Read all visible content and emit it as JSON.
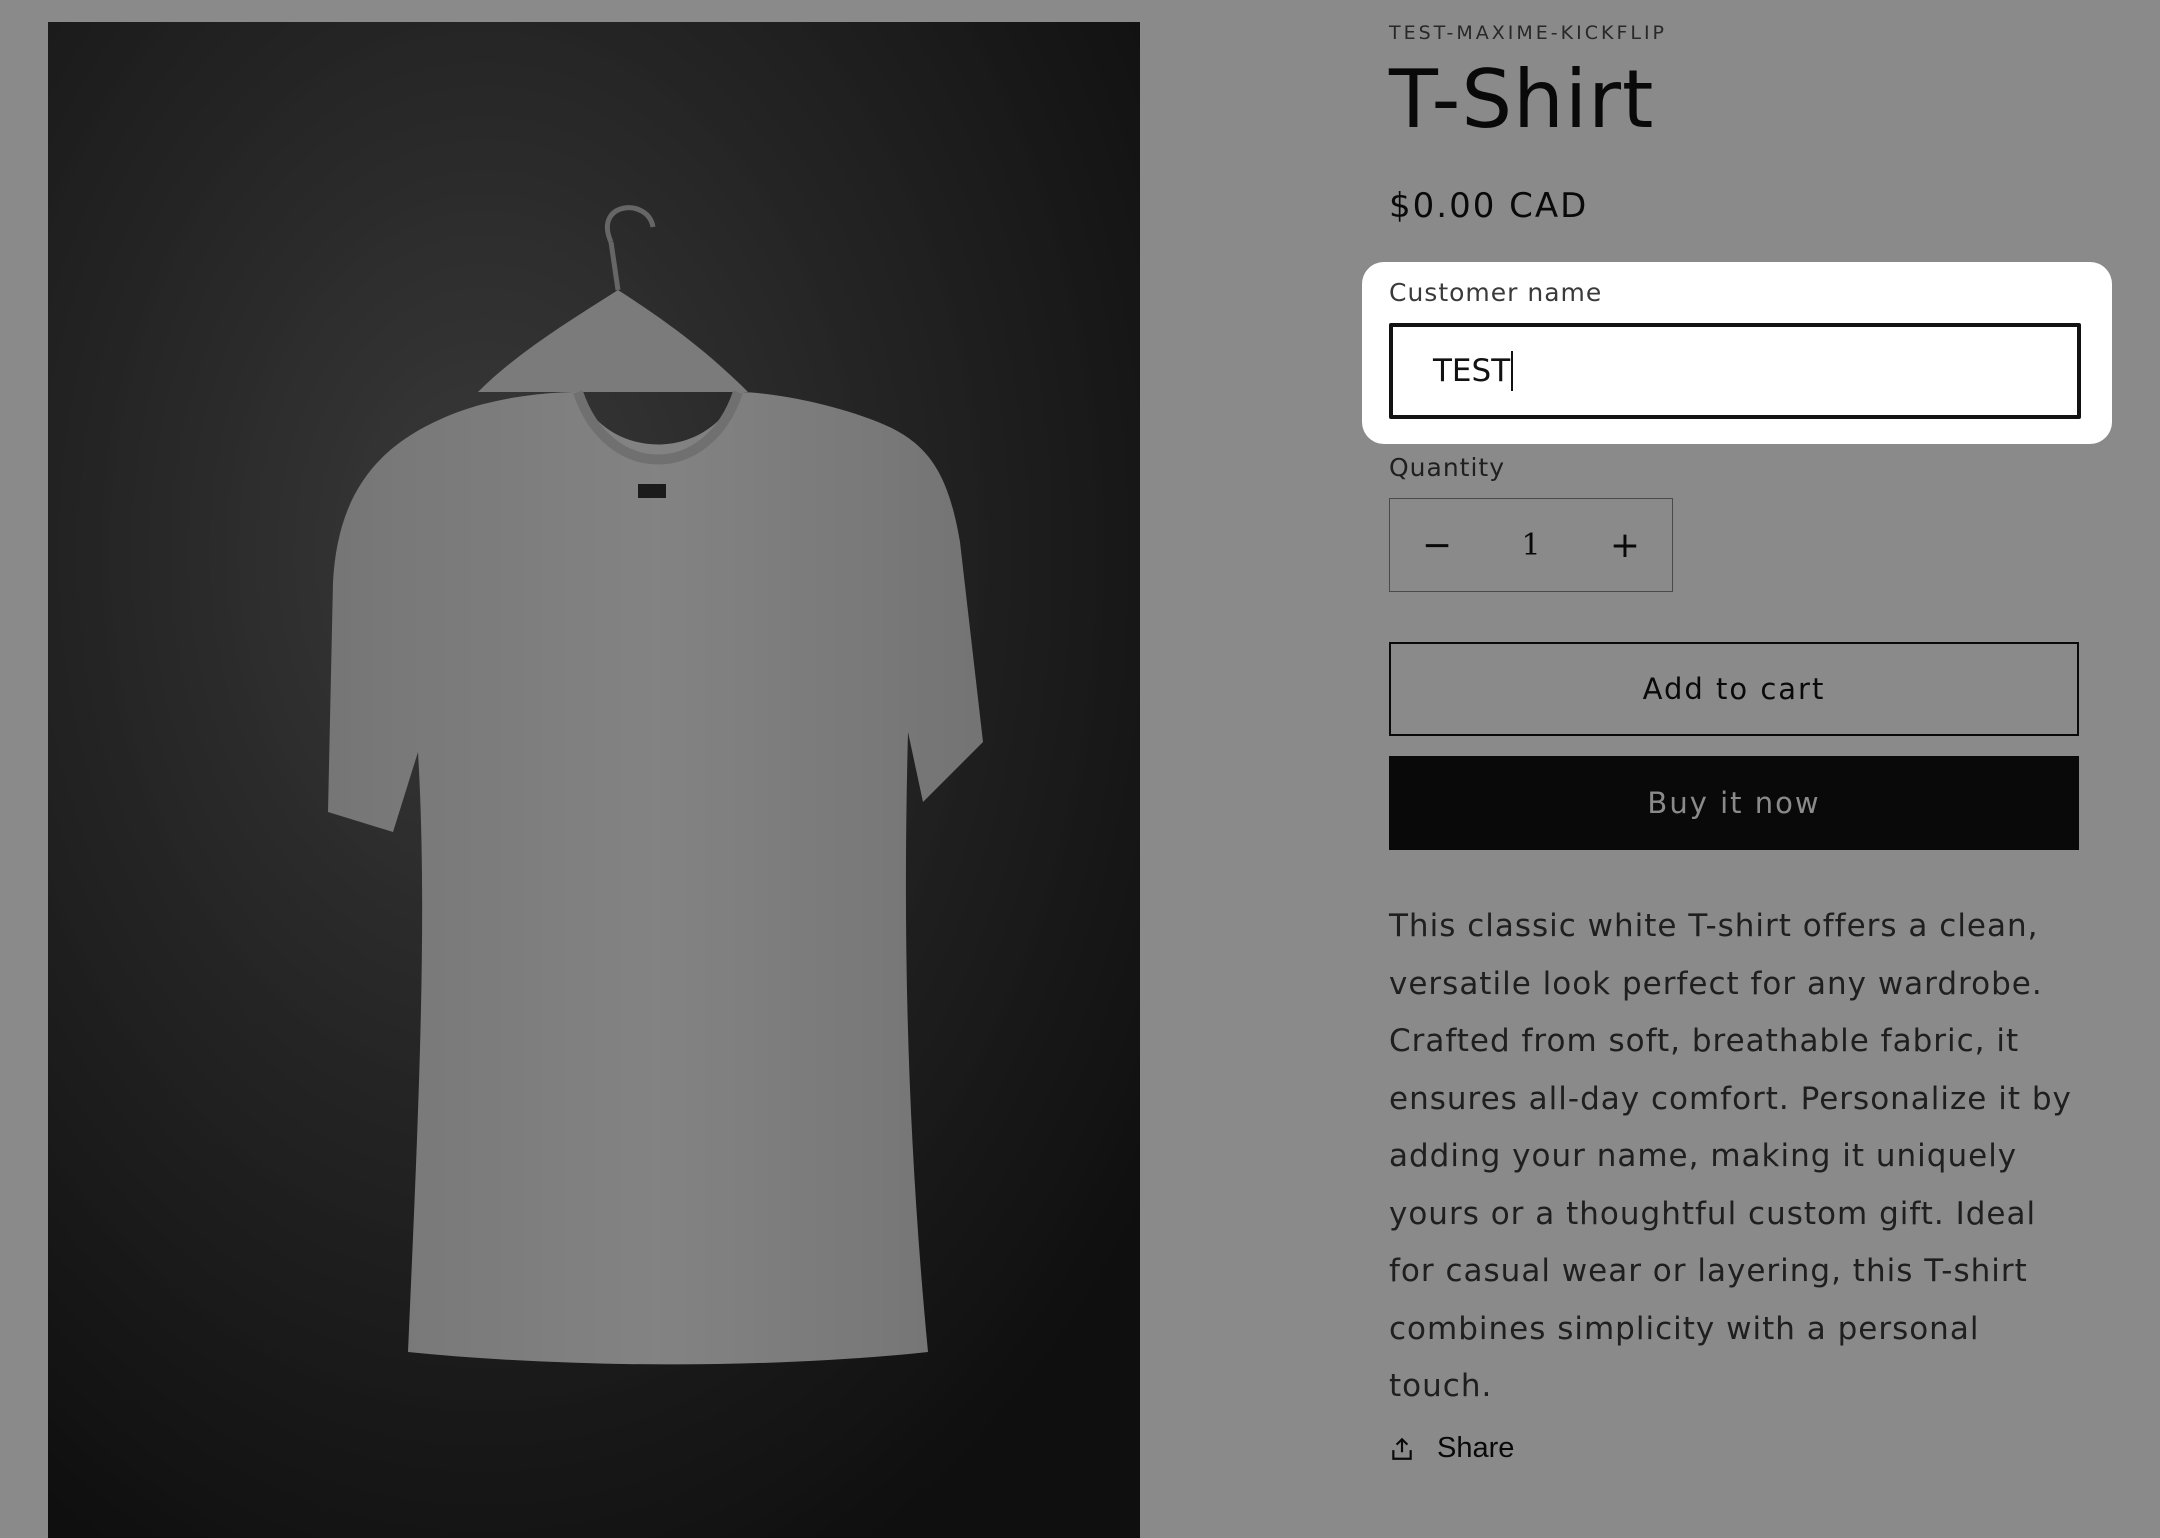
{
  "product": {
    "vendor": "TEST-MAXIME-KICKFLIP",
    "title": "T-Shirt",
    "price": "$0.00 CAD",
    "image_alt": "T-shirt on hanger"
  },
  "form": {
    "customer_name_label": "Customer name",
    "customer_name_value": "TEST",
    "quantity_label": "Quantity",
    "quantity_value": "1",
    "decrease_symbol": "−",
    "increase_symbol": "+",
    "add_to_cart_label": "Add to cart",
    "buy_now_label": "Buy it now"
  },
  "description": "This classic white T-shirt offers a clean, versatile look perfect for any wardrobe. Crafted from soft, breathable fabric, it ensures all-day comfort. Personalize it by adding your name, making it uniquely yours or a thoughtful custom gift. Ideal for casual wear or layering, this T-shirt combines simplicity with a personal touch.",
  "share": {
    "label": "Share",
    "icon": "share-icon"
  },
  "colors": {
    "overlay": "#000000",
    "primary": "#121212",
    "spotlight": "#ffffff"
  }
}
